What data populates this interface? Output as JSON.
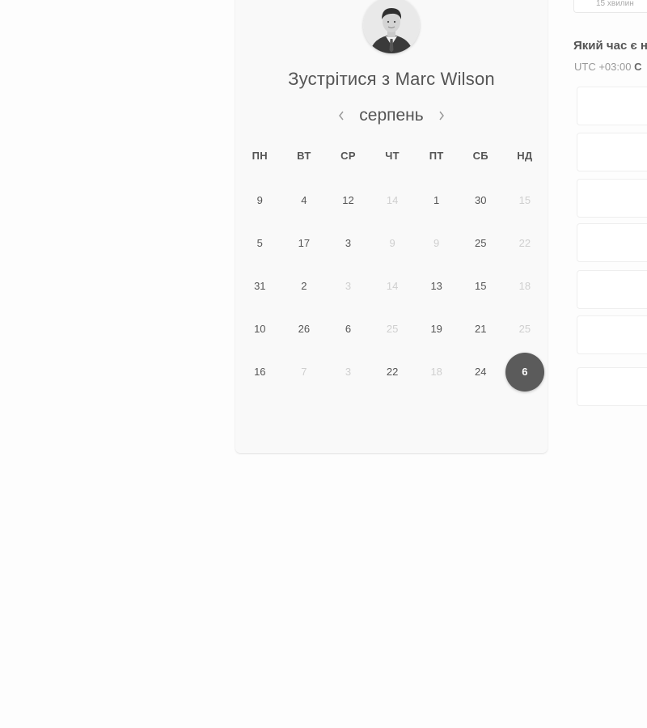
{
  "booking": {
    "title": "Зустрітися з Marc Wilson",
    "month": "серпень",
    "weekdays": [
      "ПН",
      "ВТ",
      "СР",
      "ЧТ",
      "ПТ",
      "СБ",
      "НД"
    ],
    "weeks": [
      [
        {
          "day": "9",
          "disabled": false
        },
        {
          "day": "4",
          "disabled": false
        },
        {
          "day": "12",
          "disabled": false
        },
        {
          "day": "14",
          "disabled": true
        },
        {
          "day": "1",
          "disabled": false
        },
        {
          "day": "30",
          "disabled": false
        },
        {
          "day": "15",
          "disabled": true
        }
      ],
      [
        {
          "day": "5",
          "disabled": false
        },
        {
          "day": "17",
          "disabled": false
        },
        {
          "day": "3",
          "disabled": false
        },
        {
          "day": "9",
          "disabled": true
        },
        {
          "day": "9",
          "disabled": true
        },
        {
          "day": "25",
          "disabled": false
        },
        {
          "day": "22",
          "disabled": true
        }
      ],
      [
        {
          "day": "31",
          "disabled": false
        },
        {
          "day": "2",
          "disabled": false
        },
        {
          "day": "3",
          "disabled": true
        },
        {
          "day": "14",
          "disabled": true
        },
        {
          "day": "13",
          "disabled": false
        },
        {
          "day": "15",
          "disabled": false
        },
        {
          "day": "18",
          "disabled": true
        }
      ],
      [
        {
          "day": "10",
          "disabled": false
        },
        {
          "day": "26",
          "disabled": false
        },
        {
          "day": "6",
          "disabled": false
        },
        {
          "day": "25",
          "disabled": true
        },
        {
          "day": "19",
          "disabled": false
        },
        {
          "day": "21",
          "disabled": false
        },
        {
          "day": "25",
          "disabled": true
        }
      ],
      [
        {
          "day": "16",
          "disabled": false
        },
        {
          "day": "7",
          "disabled": true
        },
        {
          "day": "3",
          "disabled": true
        },
        {
          "day": "22",
          "disabled": false
        },
        {
          "day": "18",
          "disabled": true
        },
        {
          "day": "24",
          "disabled": false
        },
        {
          "day": "6",
          "disabled": false,
          "selected": true
        }
      ]
    ],
    "icons": {
      "prev": "chevron-left-icon",
      "next": "chevron-right-icon"
    }
  },
  "sidebar": {
    "duration": "15 хвилин",
    "time_question": "Який час є н",
    "timezone_prefix": "UTC +03:00",
    "timezone_suffix": "С"
  },
  "colors": {
    "selected_day": "#5b5b5b",
    "disabled_day": "#cfcfcf",
    "text": "#555555"
  }
}
